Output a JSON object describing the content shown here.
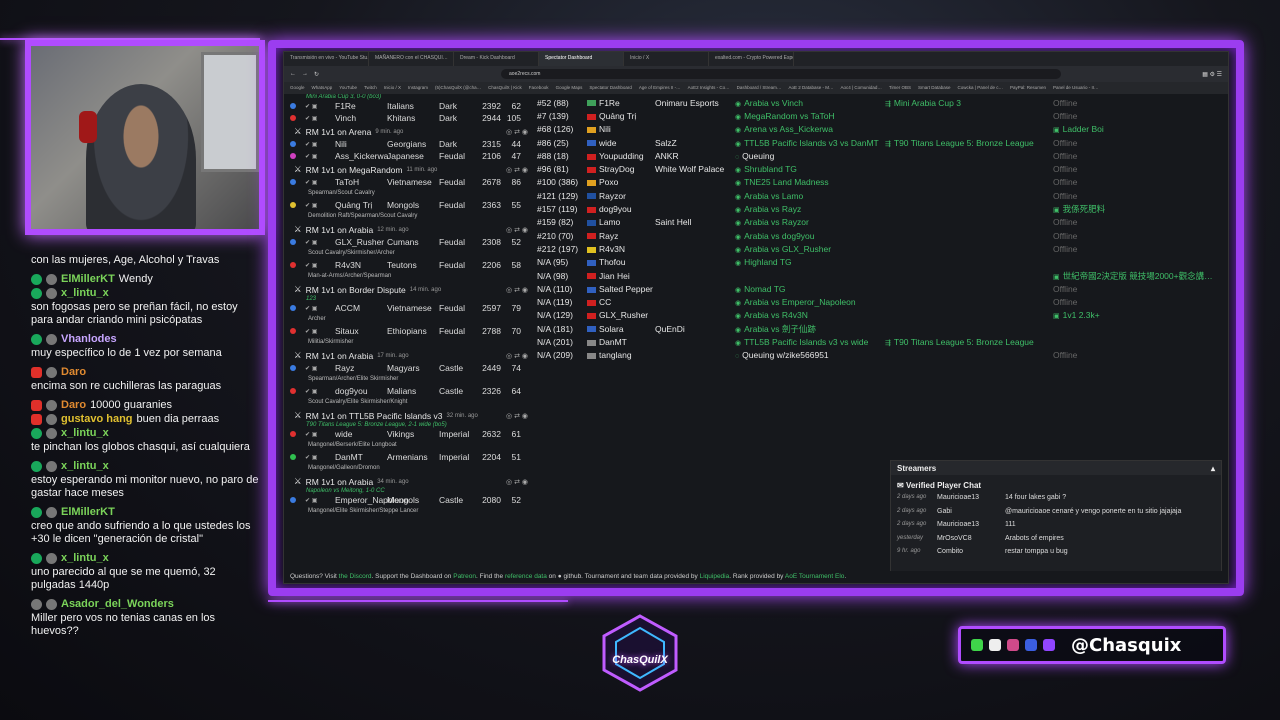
{
  "colors": {
    "accent": "#b04cff",
    "link_green": "#3fbf68",
    "offline_grey": "#666666"
  },
  "browser": {
    "tabs": [
      "Transmisión en vivo - YouTube Stu…",
      "MAÑANERO con el CHASQUI…",
      "Dream - Kick Dashboard",
      "Spectator Dashboard",
      "Inicio / X",
      "exalted.com - Crypto Powered Esports…"
    ],
    "url": "aoe2recs.com",
    "bookmarks": [
      "Google",
      "WhatsApp",
      "YouTube",
      "Twitch",
      "Inicio / X",
      "Instagram",
      "(5)ChasQuilX (@cha…",
      "ChasQuilX | Kick",
      "Facebook",
      "Google Maps",
      "Spectator Dashboard",
      "Age of Empires II -…",
      "AoE2 Insights - Co…",
      "Dashboard / Stream…",
      "AoE 2 Database - M…",
      "Aoc4 | Comunidad…",
      "Timer OBS",
      "Smart Database",
      "Cowcka | Panel de c…",
      "PayPal: Resumen",
      "Panel de Usuario - II…"
    ]
  },
  "matches": [
    {
      "title": "",
      "ago": "",
      "sub": "Mini Arabia Cup 3, 0-0 (bo3)",
      "players": [
        {
          "name": "F1Re",
          "civ": "Italians",
          "map_type": "Dark",
          "rating": "2392",
          "num": "62",
          "color": "#3a7be0",
          "civs_detail": ""
        },
        {
          "name": "Vinch",
          "civ": "Khitans",
          "map_type": "Dark",
          "rating": "2944",
          "num": "105",
          "color": "#e03030",
          "civs_detail": ""
        }
      ]
    },
    {
      "title": "RM 1v1 on Arena",
      "ago": "9 min. ago",
      "sub": "",
      "players": [
        {
          "name": "Nili",
          "civ": "Georgians",
          "map_type": "Dark",
          "rating": "2315",
          "num": "44",
          "color": "#3a7be0",
          "civs_detail": ""
        },
        {
          "name": "Ass_Kickerwa",
          "civ": "Japanese",
          "map_type": "Feudal",
          "rating": "2106",
          "num": "47",
          "color": "#d040c0",
          "civs_detail": ""
        }
      ]
    },
    {
      "title": "RM 1v1 on MegaRandom",
      "ago": "11 min. ago",
      "sub": "",
      "players": [
        {
          "name": "TaToH",
          "civ": "Vietnamese",
          "map_type": "Feudal",
          "rating": "2678",
          "num": "86",
          "color": "#3a7be0",
          "civs_detail": "Spearman/Scout Cavalry"
        },
        {
          "name": "Quảng Trị",
          "civ": "Mongols",
          "map_type": "Feudal",
          "rating": "2363",
          "num": "55",
          "color": "#e0c030",
          "civs_detail": "Demolition Raft/Spearman/Scout Cavalry"
        }
      ]
    },
    {
      "title": "RM 1v1 on Arabia",
      "ago": "12 min. ago",
      "sub": "",
      "players": [
        {
          "name": "GLX_Rusher",
          "civ": "Cumans",
          "map_type": "Feudal",
          "rating": "2308",
          "num": "52",
          "color": "#3a7be0",
          "civs_detail": "Scout Cavalry/Skirmisher/Archer"
        },
        {
          "name": "R4v3N",
          "civ": "Teutons",
          "map_type": "Feudal",
          "rating": "2206",
          "num": "58",
          "color": "#e03030",
          "civs_detail": "Man-at-Arms/Archer/Spearman"
        }
      ]
    },
    {
      "title": "RM 1v1 on Border Dispute",
      "ago": "14 min. ago",
      "sub": "123",
      "players": [
        {
          "name": "ACCM",
          "civ": "Vietnamese",
          "map_type": "Feudal",
          "rating": "2597",
          "num": "79",
          "color": "#3a7be0",
          "civs_detail": "Archer"
        },
        {
          "name": "Sitaux",
          "civ": "Ethiopians",
          "map_type": "Feudal",
          "rating": "2788",
          "num": "70",
          "color": "#e03030",
          "civs_detail": "Militia/Skirmisher"
        }
      ]
    },
    {
      "title": "RM 1v1 on Arabia",
      "ago": "17 min. ago",
      "sub": "",
      "players": [
        {
          "name": "Rayz",
          "civ": "Magyars",
          "map_type": "Castle",
          "rating": "2449",
          "num": "74",
          "color": "#3a7be0",
          "civs_detail": "Spearman/Archer/Elite Skirmisher"
        },
        {
          "name": "dog9you",
          "civ": "Malians",
          "map_type": "Castle",
          "rating": "2326",
          "num": "64",
          "color": "#e03030",
          "civs_detail": "Scout Cavalry/Elite Skirmisher/Knight"
        }
      ]
    },
    {
      "title": "RM 1v1 on TTL5B Pacific Islands v3",
      "ago": "32 min. ago",
      "sub": "T90 Titans League 5: Bronze League, 2-1 wide (bo5)",
      "players": [
        {
          "name": "wide",
          "civ": "Vikings",
          "map_type": "Imperial",
          "rating": "2632",
          "num": "61",
          "color": "#e03030",
          "civs_detail": "Mangonel/Berserk/Elite Longboat"
        },
        {
          "name": "DanMT",
          "civ": "Armenians",
          "map_type": "Imperial",
          "rating": "2204",
          "num": "51",
          "color": "#30c050",
          "civs_detail": "Mangonel/Galleon/Dromon"
        }
      ]
    },
    {
      "title": "RM 1v1 on Arabia",
      "ago": "34 min. ago",
      "sub": "Napoleon vs Meitong, 1-0 CC",
      "players": [
        {
          "name": "Emperor_Napoleon",
          "civ": "Mongols",
          "map_type": "Castle",
          "rating": "2080",
          "num": "52",
          "color": "#3a7be0",
          "civs_detail": "Mangonel/Elite Skirmisher/Steppe Lancer"
        }
      ]
    }
  ],
  "leaderboard": [
    {
      "rank": "#52 (88)",
      "name": "F1Re",
      "team": "Onimaru Esports",
      "status": "Arabia vs Vinch",
      "stream": "Mini Arabia Cup 3",
      "online": "Offline",
      "flag": "#3fa05a"
    },
    {
      "rank": "#7 (139)",
      "name": "Quảng Trị",
      "team": "",
      "status": "MegaRandom vs TaToH",
      "stream": "",
      "online": "Offline",
      "flag": "#d02020"
    },
    {
      "rank": "#68 (126)",
      "name": "Nili",
      "team": "",
      "status": "Arena vs Ass_Kickerwa",
      "stream": "",
      "online": "Ladder Boi",
      "flag": "#e0a020"
    },
    {
      "rank": "#86 (25)",
      "name": "wide",
      "team": "SalzZ",
      "status": "TTL5B Pacific Islands v3 vs DanMT",
      "stream": "T90 Titans League 5: Bronze League",
      "online": "Offline",
      "flag": "#3060c0"
    },
    {
      "rank": "#88 (18)",
      "name": "Youpudding",
      "team": "ANKR",
      "status": "Queuing",
      "stream": "",
      "online": "Offline",
      "flag": "#d02020"
    },
    {
      "rank": "#96 (81)",
      "name": "StrayDog",
      "team": "White Wolf Palace",
      "status": "Shrubland TG",
      "stream": "",
      "online": "Offline",
      "flag": "#d02020"
    },
    {
      "rank": "#100 (386)",
      "name": "Poxo",
      "team": "",
      "status": "TNE25 Land Madness",
      "stream": "",
      "online": "Offline",
      "flag": "#e0a020"
    },
    {
      "rank": "#121 (129)",
      "name": "Rayzor",
      "team": "",
      "status": "Arabia vs Lamo",
      "stream": "",
      "online": "Offline",
      "flag": "#2050a0"
    },
    {
      "rank": "#157 (119)",
      "name": "dog9you",
      "team": "",
      "status": "Arabia vs Rayz",
      "stream": "",
      "online": "我係死肥料",
      "flag": "#d02020"
    },
    {
      "rank": "#159 (82)",
      "name": "Lamo",
      "team": "Saint Hell",
      "status": "Arabia vs Rayzor",
      "stream": "",
      "online": "Offline",
      "flag": "#2050a0"
    },
    {
      "rank": "#210 (70)",
      "name": "Rayz",
      "team": "",
      "status": "Arabia vs dog9you",
      "stream": "",
      "online": "Offline",
      "flag": "#d02020"
    },
    {
      "rank": "#212 (197)",
      "name": "R4v3N",
      "team": "",
      "status": "Arabia vs GLX_Rusher",
      "stream": "",
      "online": "Offline",
      "flag": "#e0c020"
    },
    {
      "rank": "N/A (95)",
      "name": "Thofou",
      "team": "",
      "status": "Highland TG",
      "stream": "",
      "online": "",
      "flag": "#3060c0"
    },
    {
      "rank": "N/A (98)",
      "name": "Jian Hei",
      "team": "",
      "status": "",
      "stream": "",
      "online": "世紀帝國2決定版 競技場2000+觀念講…",
      "flag": "#d02020"
    },
    {
      "rank": "N/A (110)",
      "name": "Salted Pepper",
      "team": "",
      "status": "Nomad TG",
      "stream": "",
      "online": "Offline",
      "flag": "#3060c0"
    },
    {
      "rank": "N/A (119)",
      "name": "CC",
      "team": "",
      "status": "Arabia vs Emperor_Napoleon",
      "stream": "",
      "online": "Offline",
      "flag": "#d02020"
    },
    {
      "rank": "N/A (129)",
      "name": "GLX_Rusher",
      "team": "",
      "status": "Arabia vs R4v3N",
      "stream": "",
      "online": "1v1 2.3k+",
      "flag": "#d02020"
    },
    {
      "rank": "N/A (181)",
      "name": "Solara",
      "team": "QuEnDi",
      "status": "Arabia vs 劍子仙跡",
      "stream": "",
      "online": "",
      "flag": "#3060c0"
    },
    {
      "rank": "N/A (201)",
      "name": "DanMT",
      "team": "",
      "status": "TTL5B Pacific Islands v3 vs wide",
      "stream": "T90 Titans League 5: Bronze League",
      "online": "",
      "flag": "#888888"
    },
    {
      "rank": "N/A (209)",
      "name": "tanglang",
      "team": "",
      "status": "Queuing w/zike566951",
      "stream": "",
      "online": "Offline",
      "flag": "#888888"
    }
  ],
  "streamers_panel": {
    "title": "Streamers",
    "chat_title": "Verified Player Chat",
    "messages": [
      {
        "when": "2 days ago",
        "user": "Mauricioae13",
        "text": "14 four lakes gabi ?"
      },
      {
        "when": "2 days ago",
        "user": "Gabi",
        "text": "@mauricioaoe cenaré y vengo ponerte en tu sitio jajajaja"
      },
      {
        "when": "2 days ago",
        "user": "Mauricioae13",
        "text": "111"
      },
      {
        "when": "yesterday",
        "user": "MrOsoVC8",
        "text": "Arabots of empires"
      },
      {
        "when": "9 hr. ago",
        "user": "Combito",
        "text": "restar tomppa u bug"
      }
    ]
  },
  "footer": {
    "q": "Questions? Visit",
    "discord": "the Discord",
    "support": ". Support the Dashboard on",
    "patreon": "Patreon",
    "find": ". Find the",
    "ref": "reference data",
    "on": "on",
    "github": "github. Tournament and team data provided by",
    "liquipedia": "Liquipedia",
    "rank": ". Rank provided by",
    "aoe": "AoE Tournament Elo",
    "end": "."
  },
  "chat": [
    {
      "user": "",
      "msg": "con las mujeres, Age, Alcohol y Travas",
      "color": "#ffffff",
      "badge": ""
    },
    {
      "user": "ElMillerKT",
      "msg": "Wendy",
      "color": "#7bd45a",
      "badge": "mod"
    },
    {
      "user": "x_lintu_x",
      "msg": "",
      "color": "#7bd45a",
      "badge": "mod"
    },
    {
      "user": "",
      "msg": "son fogosas pero se preñan fácil, no estoy para andar criando mini psicópatas",
      "color": "#ffffff",
      "badge": ""
    },
    {
      "user": "Vhanlodes",
      "msg": "",
      "color": "#c7a6ff",
      "badge": "mod"
    },
    {
      "user": "",
      "msg": "muy específico lo de 1 vez por semana",
      "color": "#ffffff",
      "badge": ""
    },
    {
      "user": "Daro",
      "msg": "",
      "color": "#e08a30",
      "badge": "yt"
    },
    {
      "user": "",
      "msg": "encima son re cuchilleras las paraguas",
      "color": "#ffffff",
      "badge": ""
    },
    {
      "user": "Daro",
      "msg": "10000 guaranies",
      "color": "#e08a30",
      "badge": "yt"
    },
    {
      "user": "gustavo hang",
      "msg": "buen dia perraas",
      "color": "#e0c030",
      "badge": "yt"
    },
    {
      "user": "x_lintu_x",
      "msg": "",
      "color": "#7bd45a",
      "badge": "mod"
    },
    {
      "user": "",
      "msg": "te pinchan los globos chasqui, así cualquiera",
      "color": "#ffffff",
      "badge": ""
    },
    {
      "user": "x_lintu_x",
      "msg": "",
      "color": "#7bd45a",
      "badge": "mod"
    },
    {
      "user": "",
      "msg": "estoy esperando mi monitor nuevo, no paro de gastar hace meses",
      "color": "#ffffff",
      "badge": ""
    },
    {
      "user": "ElMillerKT",
      "msg": "",
      "color": "#7bd45a",
      "badge": "mod"
    },
    {
      "user": "",
      "msg": "creo que ando sufriendo a lo que ustedes los +30 le dicen \"generación de cristal\"",
      "color": "#ffffff",
      "badge": ""
    },
    {
      "user": "x_lintu_x",
      "msg": "",
      "color": "#7bd45a",
      "badge": "mod"
    },
    {
      "user": "",
      "msg": "uno parecido al que se me quemó, 32 pulgadas 1440p",
      "color": "#ffffff",
      "badge": ""
    },
    {
      "user": "Asador_del_Wonders",
      "msg": "",
      "color": "#7bd45a",
      "badge": "grey"
    },
    {
      "user": "",
      "msg": "Miller pero vos no tenias canas en los huevos??",
      "color": "#ffffff",
      "badge": ""
    }
  ],
  "brand": {
    "logo_text": "ChasQuilX",
    "handle": "@Chasquix"
  }
}
